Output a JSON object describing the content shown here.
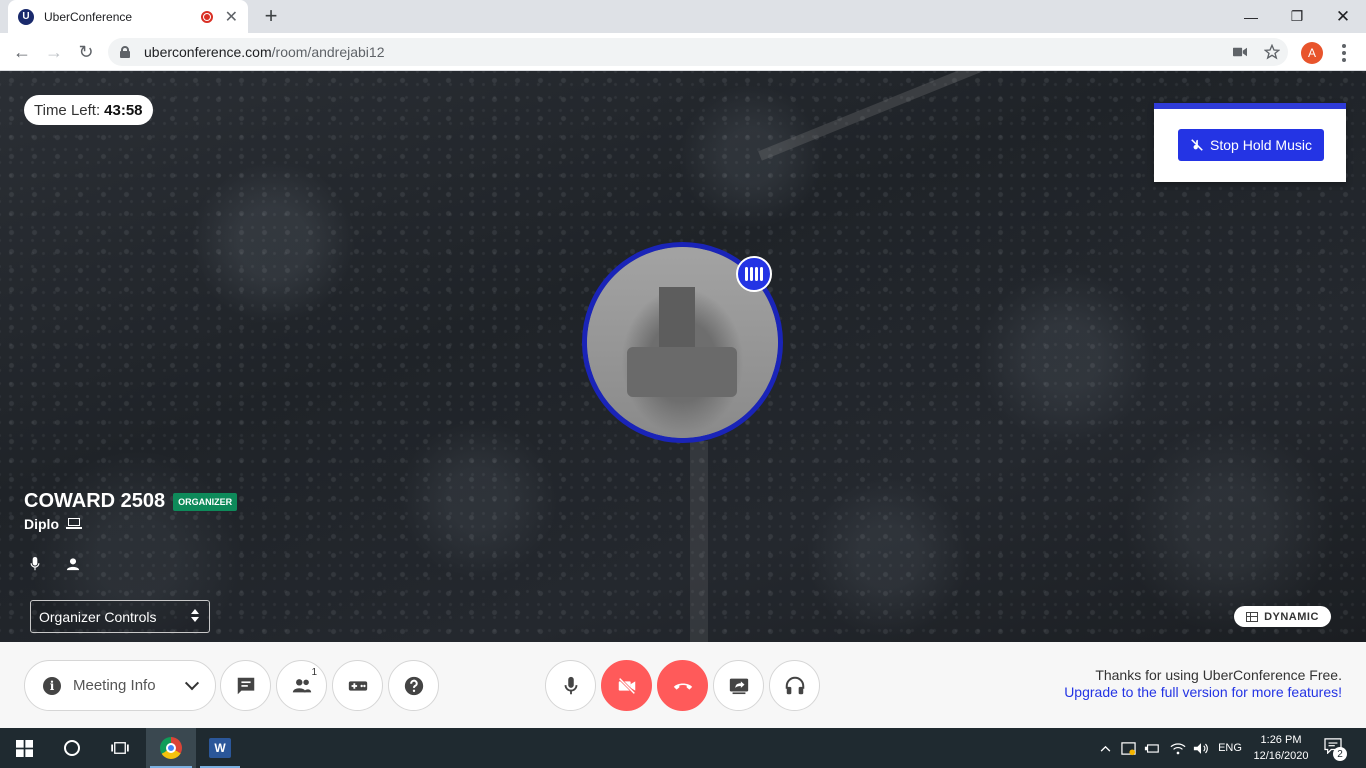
{
  "browser": {
    "tab_title": "UberConference",
    "tab_favicon_letter": "U",
    "url_host": "uberconference.com",
    "url_path": "/room/andrejabi12",
    "profile_initial": "A"
  },
  "stage": {
    "time_left_label": "Time Left:",
    "time_left_value": "43:58",
    "stop_hold_music_label": "Stop Hold Music",
    "participant_name": "COWARD 2508",
    "participant_badge": "ORGANIZER",
    "participant_device": "Diplo",
    "organizer_controls_value": "Organizer Controls",
    "view_mode_label": "DYNAMIC"
  },
  "controls": {
    "meeting_info_label": "Meeting Info",
    "participants_count": "1",
    "free_note_line1": "Thanks for using UberConference Free.",
    "free_note_line2": "Upgrade to the full version for more features!",
    "colors": {
      "hang_up": "#ff5a5a",
      "accent": "#2434e4",
      "organizer_badge": "#0e8a5a"
    }
  },
  "taskbar": {
    "language": "ENG",
    "time": "1:26 PM",
    "date": "12/16/2020",
    "notification_count": "2",
    "icons": [
      "windows-start-icon",
      "cortana-icon",
      "task-view-icon",
      "chrome-icon",
      "word-icon"
    ]
  }
}
